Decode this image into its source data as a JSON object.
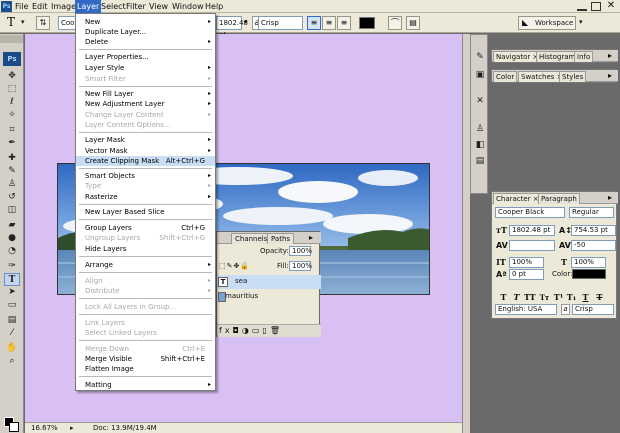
{
  "menubar": {
    "items": [
      "File",
      "Edit",
      "Image",
      "Layer",
      "Select",
      "Filter",
      "View",
      "Window",
      "Help"
    ],
    "active_index": 3
  },
  "options_bar": {
    "font_family_partial": "Coo",
    "font_size": "1802.48 pt",
    "aa_label": "a",
    "anti_alias": "Crisp",
    "workspace": "Workspace"
  },
  "layer_menu": {
    "new": "New",
    "duplicate": "Duplicate Layer...",
    "delete": "Delete",
    "properties": "Layer Properties...",
    "style": "Layer Style",
    "smart_filter": "Smart Filter",
    "new_fill": "New Fill Layer",
    "new_adjustment": "New Adjustment Layer",
    "change_content": "Change Layer Content",
    "content_options": "Layer Content Options...",
    "layer_mask": "Layer Mask",
    "vector_mask": "Vector Mask",
    "clipping_mask": "Create Clipping Mask",
    "clipping_shortcut": "Alt+Ctrl+G",
    "smart_objects": "Smart Objects",
    "type": "Type",
    "rasterize": "Rasterize",
    "slice": "New Layer Based Slice",
    "group": "Group Layers",
    "group_shortcut": "Ctrl+G",
    "ungroup": "Ungroup Layers",
    "ungroup_shortcut": "Shift+Ctrl+G",
    "hide": "Hide Layers",
    "arrange": "Arrange",
    "align": "Align",
    "distribute": "Distribute",
    "lock_all": "Lock All Layers in Group...",
    "link": "Link Layers",
    "select_linked": "Select Linked Layers",
    "merge_down": "Merge Down",
    "merge_down_shortcut": "Ctrl+E",
    "merge_visible": "Merge Visible",
    "merge_visible_shortcut": "Shift+Ctrl+E",
    "flatten": "Flatten Image",
    "matting": "Matting"
  },
  "layers_panel": {
    "tabs": [
      "Channels",
      "Paths"
    ],
    "opacity_label": "Opacity:",
    "opacity_value": "100%",
    "fill_label": "Fill:",
    "fill_value": "100%",
    "text_layer": "sea",
    "image_layer": "mauritius"
  },
  "status": {
    "zoom": "16.67%",
    "doc": "Doc: 13.9M/19.4M"
  },
  "navigator_panel": {
    "tabs": [
      "Navigator",
      "Histogram",
      "Info"
    ]
  },
  "color_panel": {
    "tabs": [
      "Color",
      "Swatches",
      "Styles"
    ]
  },
  "character_panel": {
    "tabs": [
      "Character",
      "Paragraph"
    ],
    "font_family": "Cooper Black",
    "font_style": "Regular",
    "font_size": "1802.48 pt",
    "leading": "754.53 pt",
    "tracking": "-50",
    "vertical_scale": "100%",
    "horizontal_scale": "100%",
    "baseline_shift": "0 pt",
    "color_label": "Color:",
    "language": "English: USA",
    "anti_alias_label": "a",
    "anti_alias": "Crisp"
  },
  "colors": {
    "canvas_bg": "#d8c0f4",
    "highlight": "#316ac5",
    "text_color_swatch": "#000000"
  }
}
